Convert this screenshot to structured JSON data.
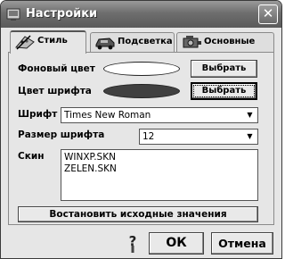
{
  "window": {
    "title": "Настройки",
    "close_glyph": "✕"
  },
  "tabs": [
    {
      "label": "Стиль",
      "icon": "palette-icon",
      "active": true
    },
    {
      "label": "Подсветка",
      "icon": "car-icon",
      "active": false
    },
    {
      "label": "Основные",
      "icon": "engine-icon",
      "active": false
    }
  ],
  "style_tab": {
    "background_color": {
      "label": "Фоновый цвет",
      "value": "#ffffff",
      "button": "Выбрать"
    },
    "font_color": {
      "label": "Цвет шрифта",
      "value": "#404040",
      "button": "Выбрать"
    },
    "font": {
      "label": "Шрифт",
      "value": "Times New Roman"
    },
    "font_size": {
      "label": "Размер шрифта",
      "value": "12"
    },
    "skin": {
      "label": "Скин",
      "items": [
        "WINXP.SKN",
        "ZELEN.SKN"
      ]
    },
    "reset_button": "Востановить исходные значения"
  },
  "footer": {
    "help_glyph": "?",
    "ok": "ОК",
    "cancel": "Отмена"
  }
}
